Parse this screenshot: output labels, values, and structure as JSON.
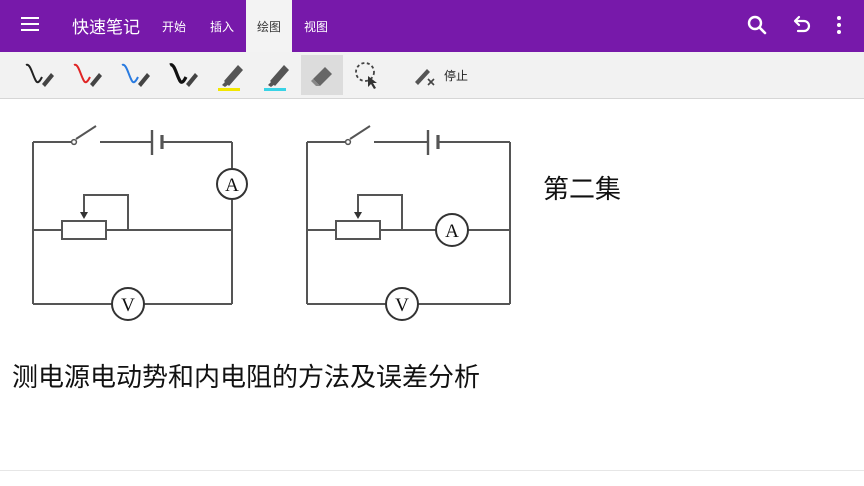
{
  "app": {
    "title": "快速笔记"
  },
  "tabs": [
    {
      "label": "开始",
      "active": false
    },
    {
      "label": "插入",
      "active": false
    },
    {
      "label": "绘图",
      "active": true
    },
    {
      "label": "视图",
      "active": false
    }
  ],
  "appbar_icons": [
    "search-icon",
    "undo-icon",
    "more-vert-icon"
  ],
  "toolbar": {
    "tools": [
      {
        "name": "pen-black",
        "color": "#222222"
      },
      {
        "name": "pen-red",
        "color": "#e02424"
      },
      {
        "name": "pen-blue",
        "color": "#2a7be0"
      },
      {
        "name": "pen-black-thick",
        "color": "#111111"
      },
      {
        "name": "highlighter-yellow",
        "color": "#f2e600"
      },
      {
        "name": "highlighter-cyan",
        "color": "#39d3e6"
      },
      {
        "name": "eraser",
        "selected": true
      },
      {
        "name": "lasso-select"
      }
    ],
    "stop_label": "停止"
  },
  "canvas": {
    "note_title": "第二集",
    "caption": "测电源电动势和内电阻的方法及误差分析",
    "circuits": [
      {
        "meter_a": "A",
        "meter_v": "V"
      },
      {
        "meter_a": "A",
        "meter_v": "V"
      }
    ]
  },
  "colors": {
    "appbar": "#7719aa",
    "toolbar": "#f2f2f2"
  }
}
